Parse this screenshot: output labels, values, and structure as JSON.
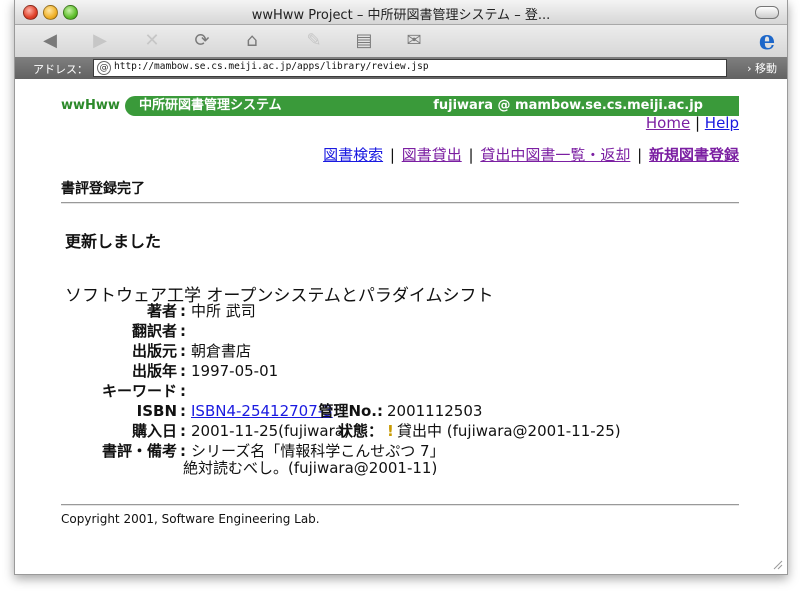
{
  "window": {
    "title": "wwHww Project – 中所研図書管理システム – 登..."
  },
  "address": {
    "label": "アドレス：",
    "url": "http://mambow.se.cs.meiji.ac.jp/apps/library/review.jsp",
    "go_label": "移動"
  },
  "banner": {
    "logo": "wwHww",
    "system": "中所研図書管理システム",
    "user": "fujiwara @ mambow.se.cs.meiji.ac.jp"
  },
  "toplinks": {
    "home": "Home",
    "help": "Help",
    "sep": "|"
  },
  "nav": {
    "search": "図書検索",
    "lend": "図書貸出",
    "list": "貸出中図書一覧・返却",
    "register": "新規図書登録",
    "sep": "|"
  },
  "page": {
    "heading": "書評登録完了",
    "message": "更新しました"
  },
  "book": {
    "title": "ソフトウェア工学 オープンシステムとパラダイムシフト",
    "author_label": "著者",
    "author": "中所 武司",
    "translator_label": "翻訳者",
    "translator": "",
    "publisher_label": "出版元",
    "publisher": "朝倉書店",
    "pubdate_label": "出版年",
    "pubdate": "1997-05-01",
    "keyword_label": "キーワード",
    "keyword": "",
    "isbn_label": "ISBN",
    "isbn": "ISBN4-25412707-3",
    "mgmt_label": "管理No.:",
    "mgmt": "2001112503",
    "purchase_label": "購入日",
    "purchase": "2001-11-25(fujiwara)",
    "status_label": "状態：",
    "status_mark": "!",
    "status": "貸出中 (fujiwara@2001-11-25)",
    "review_label": "書評・備考",
    "review_line1": "シリーズ名「情報科学こんせぷつ 7」",
    "review_line2": "絶対読むべし。(fujiwara@2001-11)",
    "colon": ":"
  },
  "footer": {
    "copyright": "Copyright 2001, Software Engineering Lab."
  },
  "colors": {
    "banner_green": "#3a9a3a",
    "link": "#1a1ae0",
    "visited": "#7b1fa2"
  },
  "icons": [
    "back-icon",
    "forward-icon",
    "stop-icon",
    "refresh-icon",
    "home-icon",
    "autofill-icon",
    "print-icon",
    "mail-icon",
    "ie-logo-icon"
  ]
}
